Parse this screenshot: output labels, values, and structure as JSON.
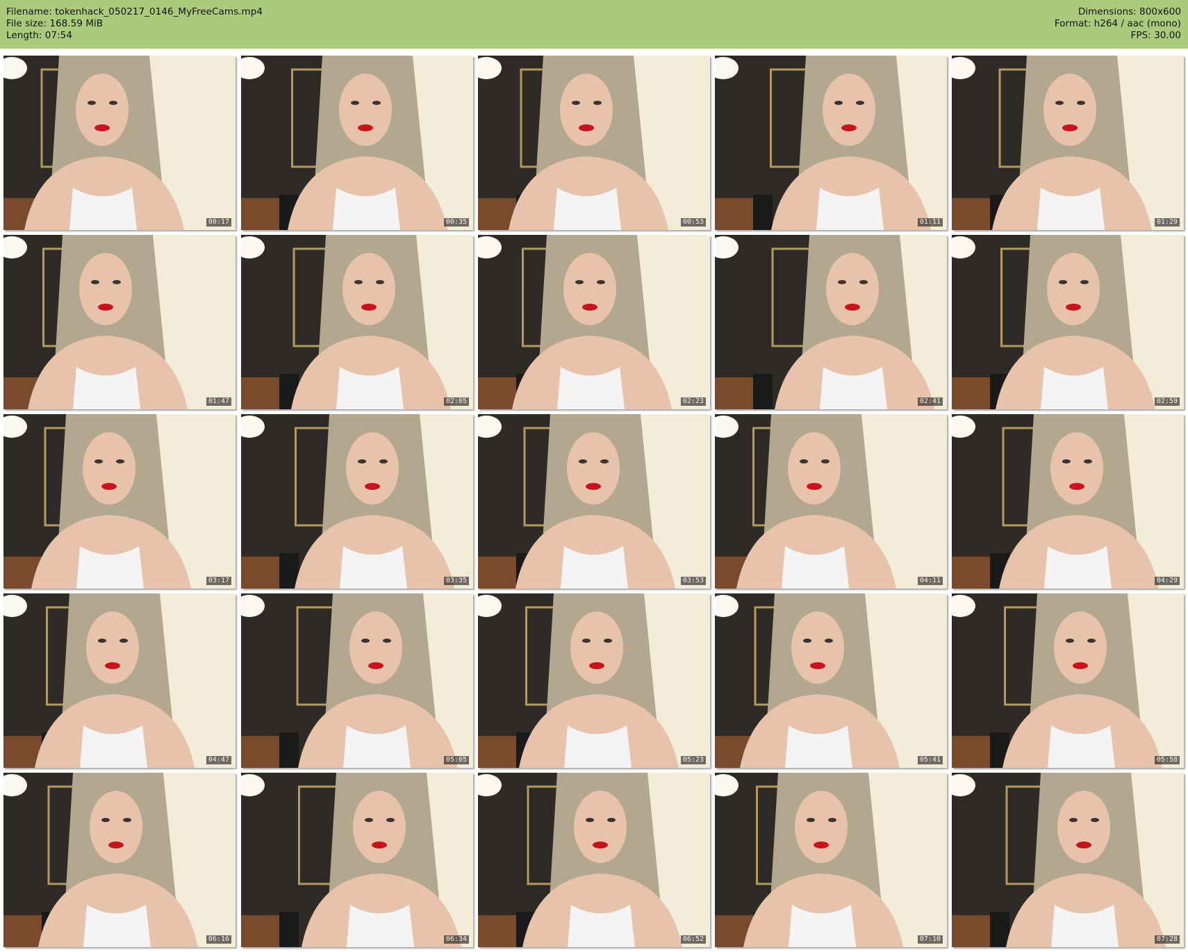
{
  "header": {
    "filename": "Filename: tokenhack_050217_0146_MyFreeCams.mp4",
    "file_size": "File size: 168.59 MiB",
    "length": "Length: 07:54",
    "dimensions": "Dimensions: 800x600",
    "format": "Format: h264 / aac (mono)",
    "fps": "FPS: 30.00"
  },
  "colors": {
    "header_bg": "#aacb7c",
    "wall_light": "#f3ecd9",
    "wall_dark": "#2e2b27",
    "hair": "#b3a88f",
    "skin": "#e7c3ac",
    "tank_top": "#f4f4f4",
    "lips": "#c8151d"
  },
  "thumbnails": [
    {
      "timestamp": "00:17"
    },
    {
      "timestamp": "00:35"
    },
    {
      "timestamp": "00:53"
    },
    {
      "timestamp": "01:11"
    },
    {
      "timestamp": "01:29"
    },
    {
      "timestamp": "01:47"
    },
    {
      "timestamp": "02:05"
    },
    {
      "timestamp": "02:23"
    },
    {
      "timestamp": "02:41"
    },
    {
      "timestamp": "02:59"
    },
    {
      "timestamp": "03:17"
    },
    {
      "timestamp": "03:35"
    },
    {
      "timestamp": "03:53"
    },
    {
      "timestamp": "04:11"
    },
    {
      "timestamp": "04:29"
    },
    {
      "timestamp": "04:47"
    },
    {
      "timestamp": "05:05"
    },
    {
      "timestamp": "05:23"
    },
    {
      "timestamp": "05:41"
    },
    {
      "timestamp": "05:58"
    },
    {
      "timestamp": "06:16"
    },
    {
      "timestamp": "06:34"
    },
    {
      "timestamp": "06:52"
    },
    {
      "timestamp": "07:10"
    },
    {
      "timestamp": "07:28"
    }
  ]
}
